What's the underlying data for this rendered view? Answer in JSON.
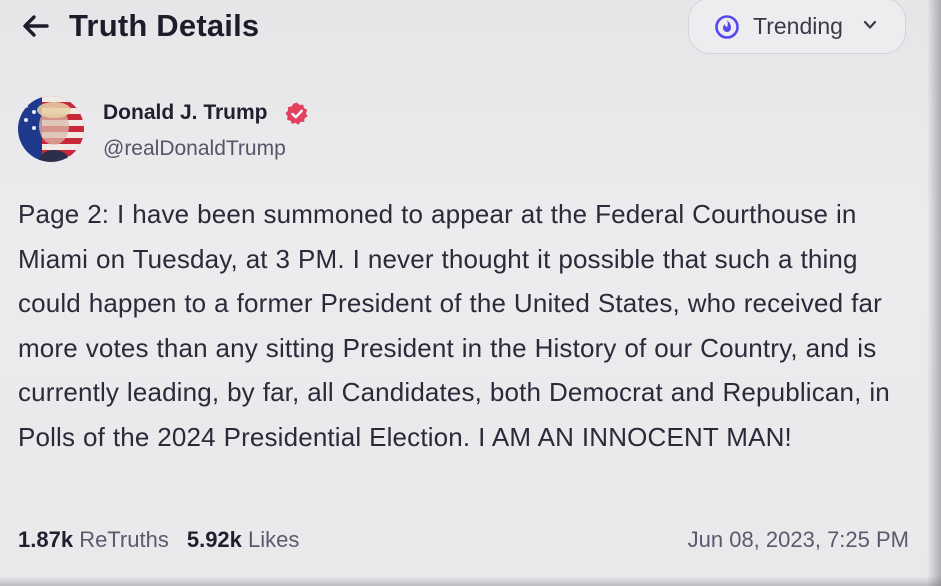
{
  "header": {
    "title": "Truth Details",
    "back_icon": "arrow-left-icon",
    "feed_selector": {
      "label": "Trending",
      "icon": "trending-icon",
      "accent_color": "#5448ee"
    }
  },
  "post": {
    "author": {
      "name": "Donald J. Trump",
      "handle": "@realDonaldTrump",
      "verified": true,
      "verified_color": "#e2425f"
    },
    "text": "Page 2: I have been summoned to appear at the Federal Courthouse in Miami on Tuesday, at 3 PM. I never thought it possible that such a thing could happen to a former President of the United States, who received far more votes than any sitting President in the History of our Country, and is currently leading, by far, all Candidates, both Democrat and Republican, in Polls of the 2024 Presidential Election. I AM AN INNOCENT MAN!",
    "stats": {
      "retruths_count": "1.87k",
      "retruths_label": "ReTruths",
      "likes_count": "5.92k",
      "likes_label": "Likes"
    },
    "timestamp": "Jun 08, 2023, 7:25 PM"
  }
}
